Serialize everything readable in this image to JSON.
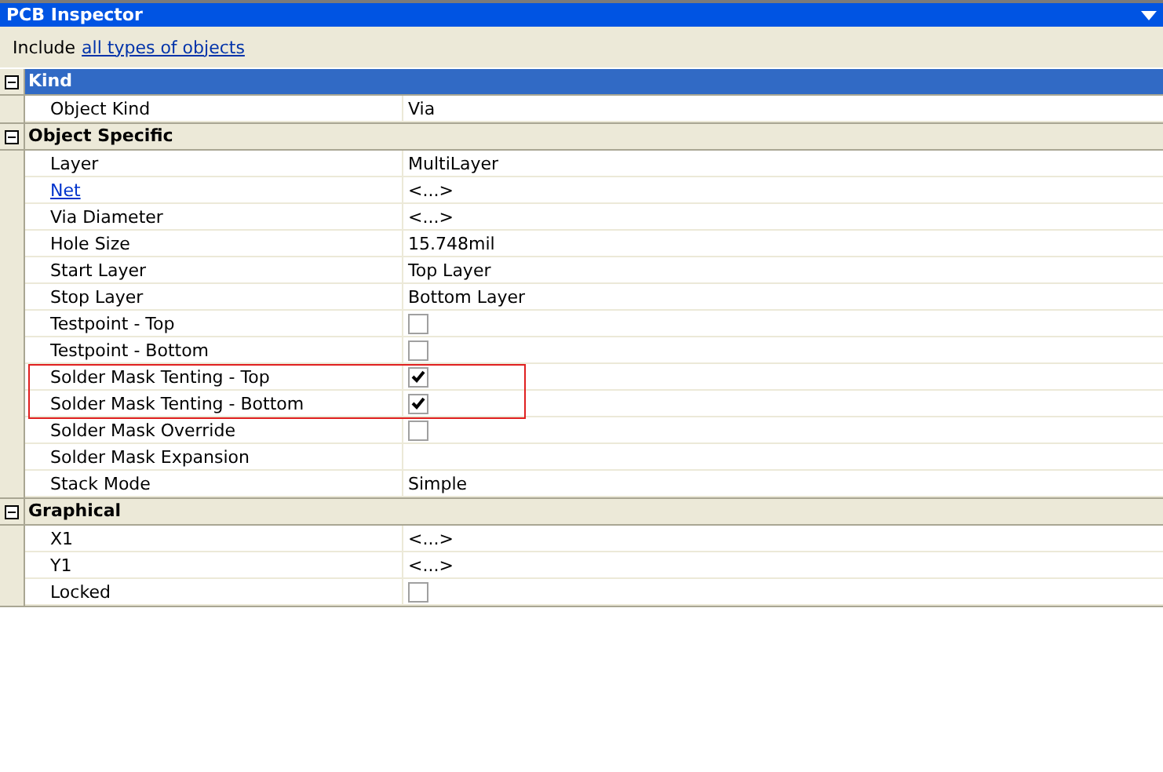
{
  "window": {
    "title": "PCB Inspector"
  },
  "filter": {
    "prefix": "Include",
    "link": "all types of objects"
  },
  "sections": [
    {
      "title": "Kind",
      "selected": true,
      "expanded": true,
      "rows": [
        {
          "name": "Object Kind",
          "kind": "text",
          "value": "Via",
          "highlighted": false
        }
      ]
    },
    {
      "title": "Object Specific",
      "selected": false,
      "expanded": true,
      "rows": [
        {
          "name": "Layer",
          "kind": "text",
          "value": "MultiLayer",
          "highlighted": false
        },
        {
          "name": "Net",
          "kind": "link",
          "value": "<...>",
          "highlighted": false
        },
        {
          "name": "Via Diameter",
          "kind": "text",
          "value": "<...>",
          "highlighted": false
        },
        {
          "name": "Hole Size",
          "kind": "text",
          "value": "15.748mil",
          "highlighted": false
        },
        {
          "name": "Start Layer",
          "kind": "text",
          "value": "Top Layer",
          "highlighted": false
        },
        {
          "name": "Stop Layer",
          "kind": "text",
          "value": "Bottom Layer",
          "highlighted": false
        },
        {
          "name": "Testpoint - Top",
          "kind": "checkbox",
          "checked": false,
          "highlighted": false
        },
        {
          "name": "Testpoint - Bottom",
          "kind": "checkbox",
          "checked": false,
          "highlighted": false
        },
        {
          "name": "Solder Mask Tenting - Top",
          "kind": "checkbox",
          "checked": true,
          "highlighted": true
        },
        {
          "name": "Solder Mask Tenting - Bottom",
          "kind": "checkbox",
          "checked": true,
          "highlighted": true
        },
        {
          "name": "Solder Mask Override",
          "kind": "checkbox",
          "checked": false,
          "highlighted": false
        },
        {
          "name": "Solder Mask Expansion",
          "kind": "empty",
          "highlighted": false
        },
        {
          "name": "Stack Mode",
          "kind": "text",
          "value": "Simple",
          "highlighted": false
        }
      ]
    },
    {
      "title": "Graphical",
      "selected": false,
      "expanded": true,
      "rows": [
        {
          "name": "X1",
          "kind": "text",
          "value": "<...>",
          "highlighted": false
        },
        {
          "name": "Y1",
          "kind": "text",
          "value": "<...>",
          "highlighted": false
        },
        {
          "name": "Locked",
          "kind": "checkbox",
          "checked": false,
          "highlighted": false
        }
      ]
    }
  ]
}
